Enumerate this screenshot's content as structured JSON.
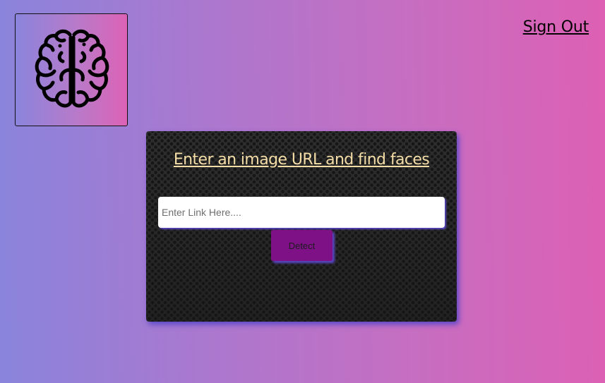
{
  "header": {
    "logo_icon": "brain-icon",
    "signout_label": "Sign Out"
  },
  "card": {
    "title": "Enter an image URL and find faces",
    "input": {
      "placeholder": "Enter Link Here....",
      "value": ""
    },
    "detect_label": "Detect"
  },
  "colors": {
    "background_start": "#8a84dc",
    "background_end": "#dd60b4",
    "card_background": "#272727",
    "title_color": "#f4dda6",
    "button_color": "#7f1187",
    "shadow_color": "#5a48c8"
  }
}
